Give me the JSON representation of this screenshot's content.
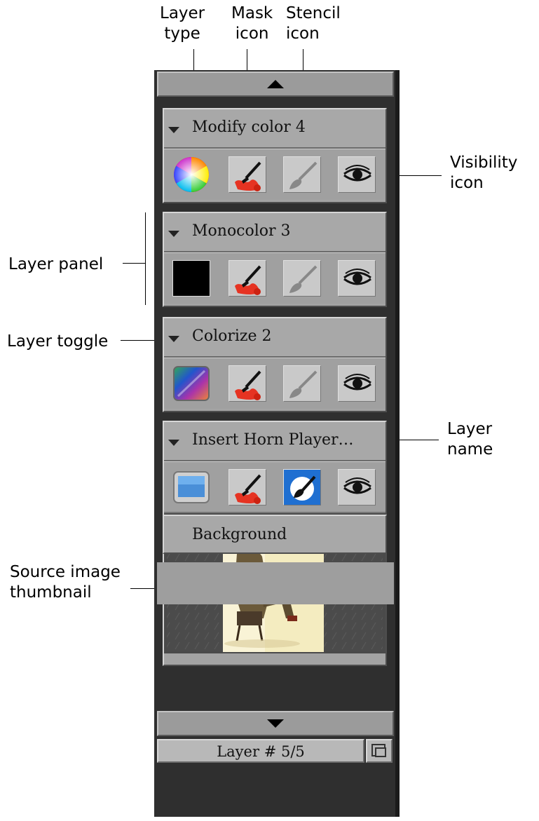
{
  "annotations": {
    "layer_type": [
      "Layer",
      "type"
    ],
    "mask_icon": [
      "Mask",
      "icon"
    ],
    "stencil_icon": [
      "Stencil",
      "icon"
    ],
    "visibility_icon": [
      "Visibility",
      "icon"
    ],
    "layer_panel": "Layer panel",
    "layer_toggle": "Layer toggle",
    "layer_name": [
      "Layer",
      "name"
    ],
    "source_thumbnail": [
      "Source image",
      "thumbnail"
    ]
  },
  "layers": [
    {
      "name": "Modify color 4",
      "type_icon": "color-wheel-icon"
    },
    {
      "name": "Monocolor 3",
      "type_icon": "black-swatch-icon"
    },
    {
      "name": "Colorize 2",
      "type_icon": "colorize-gradient-icon"
    },
    {
      "name": "Insert Horn Player…",
      "type_icon": "insert-image-icon"
    }
  ],
  "background_label": "Background",
  "status_label": "Layer # 5/5",
  "icons": {
    "scroll_up": "triangle-up-icon",
    "scroll_down": "triangle-down-icon",
    "mask": "brush-paint-icon",
    "stencil": "brush-grey-icon",
    "stencil_active": "stencil-active-icon",
    "visibility": "eye-icon",
    "status_button": "window-icon"
  },
  "colors": {
    "stencil_active_bg": "#1f6fd1",
    "panel_bg": "#a3a3a3"
  }
}
